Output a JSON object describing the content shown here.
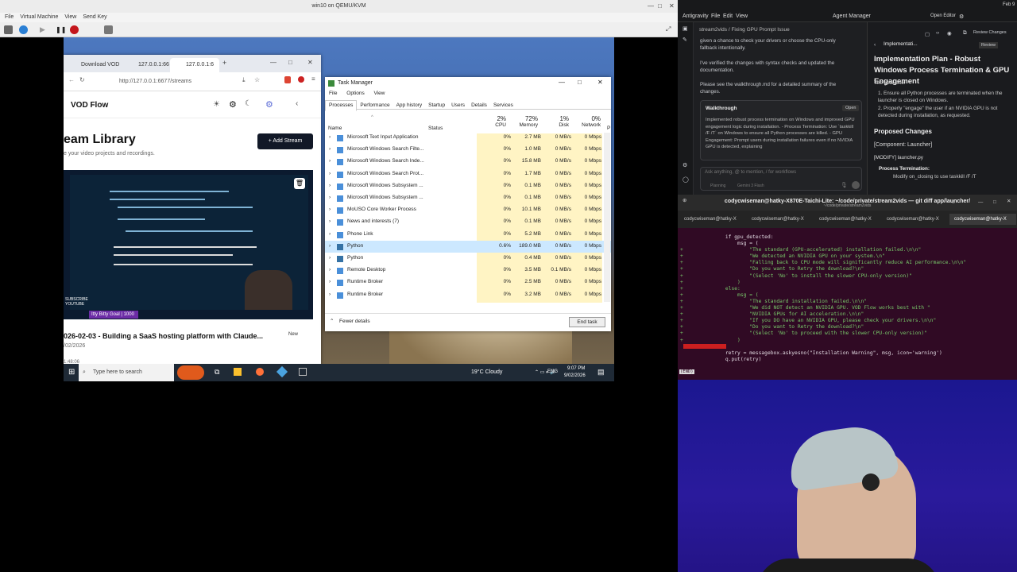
{
  "qemu": {
    "title": "win10 on QEMU/KVM",
    "menu": [
      "File",
      "Virtual Machine",
      "View",
      "Send Key"
    ]
  },
  "browser": {
    "tabs": [
      "Download VOD",
      "127.0.0.1:66",
      "127.0.0.1:6"
    ],
    "url": "http://127.0.0.1:6677/streams",
    "app_title": "VOD Flow",
    "library_title": "eam Library",
    "library_sub": "e your video projects and recordings.",
    "add_stream": "Add Stream",
    "thumb_badge": "Itty Bitty Goal | 1000",
    "thumb_labels": [
      "SUBSCRIBE",
      "YOUTUBE"
    ],
    "stream_title": "026-02-03 - Building a SaaS hosting platform with Claude...",
    "stream_date": "/02/2026",
    "stream_new": "New",
    "stream_dur": "1:48:06"
  },
  "taskmgr": {
    "title": "Task Manager",
    "menu": [
      "File",
      "Options",
      "View"
    ],
    "tabs": [
      "Processes",
      "Performance",
      "App history",
      "Startup",
      "Users",
      "Details",
      "Services"
    ],
    "headers": {
      "name": "Name",
      "status": "Status",
      "cpu_pct": "2%",
      "cpu": "CPU",
      "mem_pct": "72%",
      "mem": "Memory",
      "disk_pct": "1%",
      "disk": "Disk",
      "net_pct": "0%",
      "net": "Network",
      "power": "P"
    },
    "rows": [
      {
        "name": "Microsoft Text Input Application",
        "cpu": "0%",
        "mem": "2.7 MB",
        "disk": "0 MB/s",
        "net": "0 Mbps"
      },
      {
        "name": "Microsoft Windows Search Filte...",
        "cpu": "0%",
        "mem": "1.0 MB",
        "disk": "0 MB/s",
        "net": "0 Mbps"
      },
      {
        "name": "Microsoft Windows Search Inde...",
        "cpu": "0%",
        "mem": "15.8 MB",
        "disk": "0 MB/s",
        "net": "0 Mbps"
      },
      {
        "name": "Microsoft Windows Search Prot...",
        "cpu": "0%",
        "mem": "1.7 MB",
        "disk": "0 MB/s",
        "net": "0 Mbps"
      },
      {
        "name": "Microsoft Windows Subsystem ...",
        "cpu": "0%",
        "mem": "0.1 MB",
        "disk": "0 MB/s",
        "net": "0 Mbps"
      },
      {
        "name": "Microsoft Windows Subsystem ...",
        "cpu": "0%",
        "mem": "0.1 MB",
        "disk": "0 MB/s",
        "net": "0 Mbps"
      },
      {
        "name": "MoUSO Core Worker Process",
        "cpu": "0%",
        "mem": "10.1 MB",
        "disk": "0 MB/s",
        "net": "0 Mbps"
      },
      {
        "name": "News and interests (7)",
        "cpu": "0%",
        "mem": "0.1 MB",
        "disk": "0 MB/s",
        "net": "0 Mbps"
      },
      {
        "name": "Phone Link",
        "cpu": "0%",
        "mem": "5.2 MB",
        "disk": "0 MB/s",
        "net": "0 Mbps"
      },
      {
        "name": "Python",
        "cpu": "0.6%",
        "mem": "189.0 MB",
        "disk": "0 MB/s",
        "net": "0 Mbps"
      },
      {
        "name": "Python",
        "cpu": "0%",
        "mem": "0.4 MB",
        "disk": "0 MB/s",
        "net": "0 Mbps"
      },
      {
        "name": "Remote Desktop",
        "cpu": "0%",
        "mem": "3.5 MB",
        "disk": "0.1 MB/s",
        "net": "0 Mbps"
      },
      {
        "name": "Runtime Broker",
        "cpu": "0%",
        "mem": "2.5 MB",
        "disk": "0 MB/s",
        "net": "0 Mbps"
      },
      {
        "name": "Runtime Broker",
        "cpu": "0%",
        "mem": "3.2 MB",
        "disk": "0 MB/s",
        "net": "0 Mbps"
      }
    ],
    "fewer": "Fewer details",
    "end_task": "End task"
  },
  "taskbar": {
    "search": "Type here to search",
    "weather": "19°C  Cloudy",
    "lang": "ENG",
    "time": "9:07 PM",
    "date": "9/02/2026"
  },
  "ide": {
    "menu": [
      "Antigravity",
      "File",
      "Edit",
      "View"
    ],
    "agent_manager": "Agent Manager",
    "open_editor": "Open Editor",
    "date": "Feb 9",
    "crumb": "stream2vids  /  Fixing GPU Prompt Issue",
    "chat_lines": [
      "given a chance to check your drivers or choose the CPU-only",
      "fallback intentionally.",
      "",
      "I've verified the changes with syntax checks and updated the",
      "documentation.",
      "",
      "Please see the  walkthrough.md  for a detailed summary of the",
      "changes."
    ],
    "walk_title": "Walkthrough",
    "walk_open": "Open",
    "walk_body": "Implemented robust process termination on Windows and improved GPU engagement logic during installation. - Process Termination: Use `taskkill /F /T` on Windows to ensure all Python processes are killed. - GPU Engagement: Prompt users during installation failures even if no NVIDIA GPU is detected, explaining",
    "input_placeholder": "Ask anything, @ to mention, / for workflows",
    "input_mode": "Planning",
    "input_model": "Gemini 3 Flash",
    "plan_tab": "Implementati...",
    "plan_review": "Review",
    "review_changes": "Review Changes",
    "plan_title": "Implementation Plan - Robust Windows Process Termination & GPU Engagement",
    "plan_goal": "The goal is to:",
    "plan_items": [
      "1. Ensure all Python processes are terminated when the launcher is closed on Windows.",
      "2. Properly \"engage\" the user if an NVIDIA GPU is not detected during installation, as requested."
    ],
    "proposed": "Proposed Changes",
    "component": "[Component: Launcher]",
    "modify": "[MODIFY]  launcher.py",
    "bullet": "Process Termination:",
    "sub_bullet": "Modify  on_closing  to use  taskkill /F /T"
  },
  "terminal": {
    "title": "codycwiseman@hatky-X870E-Taichi-Lite: ~/code/private/stream2vids — git diff app/launcher/",
    "subtitle": "~/code/private/stream2vids",
    "tabs": [
      "codycwiseman@hatky-X",
      "codycwiseman@hatky-X",
      "codycwiseman@hatky-X",
      "codycwiseman@hatky-X",
      "codycwiseman@hatky-X"
    ],
    "lines": [
      "               if gpu_detected:",
      "                   msg = (",
      "+                      \"The standard (GPU-accelerated) installation failed.\\n\\n\"",
      "+                      \"We detected an NVIDIA GPU on your system.\\n\"",
      "+                      \"Falling back to CPU mode will significantly reduce AI performance.\\n\\n\"",
      "+                      \"Do you want to Retry the download?\\n\"",
      "+                      \"(Select 'No' to install the slower CPU-only version)\"",
      "+                  )",
      "+              else:",
      "+                  msg = (",
      "+                      \"The standard installation failed.\\n\\n\"",
      "+                      \"We did NOT detect an NVIDIA GPU. VOD Flow works best with \"",
      "+                      \"NVIDIA GPUs for AI acceleration.\\n\\n\"",
      "+                      \"If you DO have an NVIDIA GPU, please check your drivers.\\n\\n\"",
      "+                      \"Do you want to Retry the download?\\n\"",
      "+                      \"(Select 'No' to proceed with the slower CPU-only version)\"",
      "+                  )",
      "",
      "               retry = messagebox.askyesno(\"Installation Warning\", msg, icon='warning')",
      "               q.put(retry)"
    ],
    "end": "(END)"
  }
}
